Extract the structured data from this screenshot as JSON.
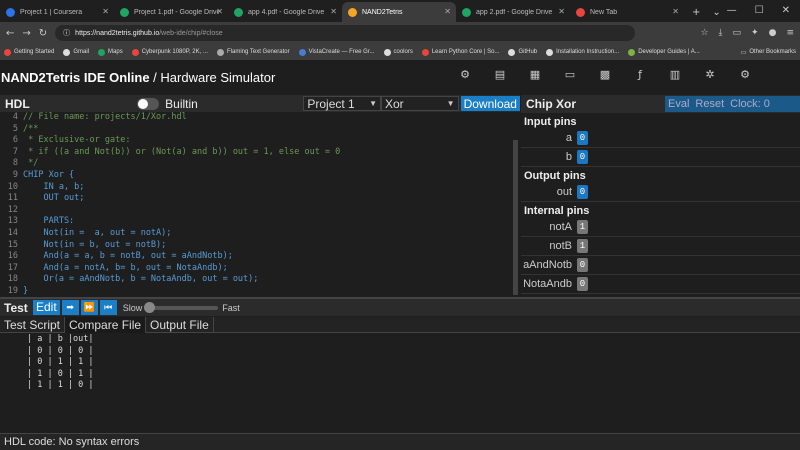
{
  "browser": {
    "tabs": [
      {
        "title": "Project 1 | Coursera",
        "color": "#2a73e8"
      },
      {
        "title": "Project 1.pdf - Google Drive",
        "color": "#1fa463"
      },
      {
        "title": "app 4.pdf - Google Drive",
        "color": "#1fa463"
      },
      {
        "title": "NAND2Tetris",
        "color": "#f4a623"
      },
      {
        "title": "app 2.pdf - Google Drive",
        "color": "#1fa463"
      },
      {
        "title": "New Tab",
        "color": "#e8453c"
      }
    ],
    "active_tab": 3,
    "url_host": "https://nand2tetris.github.io",
    "url_path": "/web-ide/chip/#close",
    "bookmarks": [
      {
        "label": "Getting Started",
        "color": "#e8453c"
      },
      {
        "label": "Gmail",
        "color": "#ddd"
      },
      {
        "label": "Maps",
        "color": "#1fa463"
      },
      {
        "label": "Cyberpunk 1080P, 2K, ...",
        "color": "#e8453c"
      },
      {
        "label": "Flaming Text Generator",
        "color": "#aaa"
      },
      {
        "label": "VistaCreate — Free Gr...",
        "color": "#4a7bd0"
      },
      {
        "label": "coolors",
        "color": "#ddd"
      },
      {
        "label": "Learn Python Core | So...",
        "color": "#e8453c"
      },
      {
        "label": "GitHub",
        "color": "#ddd"
      },
      {
        "label": "Installation Instruction...",
        "color": "#ddd"
      },
      {
        "label": "Developer Guides | A...",
        "color": "#7cb342"
      }
    ],
    "other_bookmarks": "Other Bookmarks"
  },
  "app": {
    "brand_bold": "NAND2Tetris IDE Online",
    "brand_rest": " / Hardware Simulator"
  },
  "hdl": {
    "label": "HDL",
    "builtin_label": "Builtin",
    "project": "Project 1",
    "chip": "Xor",
    "download_label": "Download"
  },
  "code_lines": [
    {
      "n": "4",
      "text": "// File name: projects/1/Xor.hdl",
      "cls": "cm"
    },
    {
      "n": "5",
      "text": "/**",
      "cls": "cm"
    },
    {
      "n": "6",
      "text": " * Exclusive-or gate:",
      "cls": "cm"
    },
    {
      "n": "7",
      "text": " * if ((a and Not(b)) or (Not(a) and b)) out = 1, else out = 0",
      "cls": "cm"
    },
    {
      "n": "8",
      "text": " */",
      "cls": "cm"
    },
    {
      "n": "9",
      "text": "CHIP Xor {",
      "cls": "kw"
    },
    {
      "n": "10",
      "text": "    IN a, b;",
      "cls": "kw"
    },
    {
      "n": "11",
      "text": "    OUT out;",
      "cls": "kw"
    },
    {
      "n": "12",
      "text": "",
      "cls": "code"
    },
    {
      "n": "13",
      "text": "    PARTS:",
      "cls": "kw"
    },
    {
      "n": "14",
      "text": "    Not(in =  a, out = notA);",
      "cls": "kw"
    },
    {
      "n": "15",
      "text": "    Not(in = b, out = notB);",
      "cls": "kw"
    },
    {
      "n": "16",
      "text": "    And(a = a, b = notB, out = aAndNotb);",
      "cls": "kw"
    },
    {
      "n": "17",
      "text": "    And(a = notA, b= b, out = NotaAndb);",
      "cls": "kw"
    },
    {
      "n": "18",
      "text": "    Or(a = aAndNotb, b = NotaAndb, out = out);",
      "cls": "kw"
    },
    {
      "n": "19",
      "text": "}",
      "cls": "kw"
    }
  ],
  "chip": {
    "title": "Chip Xor",
    "eval_label": "Eval",
    "reset_label": "Reset",
    "clock_label": "Clock: 0",
    "input_heading": "Input pins",
    "output_heading": "Output pins",
    "internal_heading": "Internal pins",
    "input_pins": [
      {
        "name": "a",
        "value": "0"
      },
      {
        "name": "b",
        "value": "0"
      }
    ],
    "output_pins": [
      {
        "name": "out",
        "value": "0"
      }
    ],
    "internal_pins": [
      {
        "name": "notA",
        "value": "1"
      },
      {
        "name": "notB",
        "value": "1"
      },
      {
        "name": "aAndNotb",
        "value": "0"
      },
      {
        "name": "NotaAndb",
        "value": "0"
      }
    ]
  },
  "test": {
    "label": "Test",
    "edit_label": "Edit",
    "slow_label": "Slow",
    "fast_label": "Fast",
    "tabs": [
      "Test Script",
      "Compare File",
      "Output File"
    ],
    "active_tab": 1,
    "compare_rows": [
      "| a | b |out|",
      "| 0 | 0 | 0 |",
      "| 0 | 1 | 1 |",
      "| 1 | 0 | 1 |",
      "| 1 | 1 | 0 |"
    ]
  },
  "status": "HDL code: No syntax errors"
}
